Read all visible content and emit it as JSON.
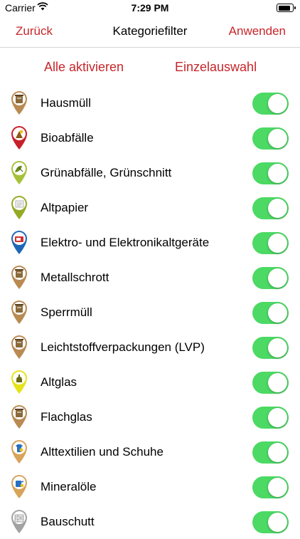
{
  "status_bar": {
    "carrier": "Carrier",
    "time": "7:29 PM",
    "battery_level": 0.85
  },
  "nav": {
    "back_label": "Zurück",
    "title": "Kategoriefilter",
    "apply_label": "Anwenden"
  },
  "actions": {
    "activate_all_label": "Alle aktivieren",
    "single_select_label": "Einzelauswahl"
  },
  "colors": {
    "accent": "#c6262a",
    "toggle_on": "#4cd964"
  },
  "categories": [
    {
      "label": "Hausmüll",
      "pin_color": "#b98a52",
      "icon": "trash-bin-icon",
      "enabled": true
    },
    {
      "label": "Bioabfälle",
      "pin_color": "#c81f2a",
      "icon": "bio-waste-icon",
      "enabled": true
    },
    {
      "label": "Grünabfälle, Grünschnitt",
      "pin_color": "#a6c23a",
      "icon": "green-waste-icon",
      "enabled": true
    },
    {
      "label": "Altpapier",
      "pin_color": "#95aa26",
      "icon": "paper-icon",
      "enabled": true
    },
    {
      "label": "Elektro- und Elektronikaltgeräte",
      "pin_color": "#1e67b5",
      "icon": "electronics-icon",
      "enabled": true
    },
    {
      "label": "Metallschrott",
      "pin_color": "#b98a52",
      "icon": "trash-bin-icon",
      "enabled": true
    },
    {
      "label": "Sperrmüll",
      "pin_color": "#b98a52",
      "icon": "trash-bin-icon",
      "enabled": true
    },
    {
      "label": "Leichtstoffverpackungen (LVP)",
      "pin_color": "#b98a52",
      "icon": "trash-bin-icon",
      "enabled": true
    },
    {
      "label": "Altglas",
      "pin_color": "#e6e21a",
      "icon": "glass-icon",
      "enabled": true
    },
    {
      "label": "Flachglas",
      "pin_color": "#b98a52",
      "icon": "trash-bin-icon",
      "enabled": true
    },
    {
      "label": "Alttextilien und Schuhe",
      "pin_color": "#d9a35a",
      "icon": "textiles-icon",
      "enabled": true
    },
    {
      "label": "Mineralöle",
      "pin_color": "#d9a35a",
      "icon": "oil-icon",
      "enabled": true
    },
    {
      "label": "Bauschutt",
      "pin_color": "#a2a2a2",
      "icon": "rubble-icon",
      "enabled": true
    }
  ]
}
